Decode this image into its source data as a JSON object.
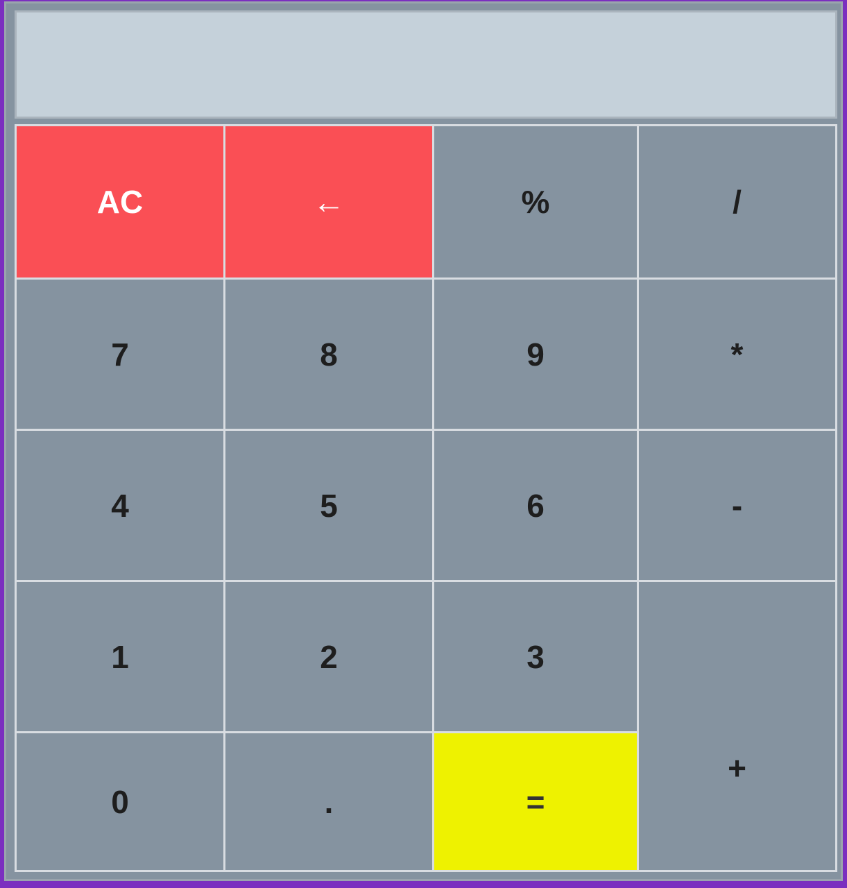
{
  "display": {
    "value": ""
  },
  "keys": {
    "clear": "AC",
    "backspace": "←",
    "percent": "%",
    "divide": "/",
    "seven": "7",
    "eight": "8",
    "nine": "9",
    "multiply": "*",
    "four": "4",
    "five": "5",
    "six": "6",
    "subtract": "-",
    "one": "1",
    "two": "2",
    "three": "3",
    "add": "+",
    "zero": "0",
    "decimal": ".",
    "equals": "="
  },
  "colors": {
    "background": "#7b2fbf",
    "display": "#c5d1da",
    "key": "#8593a0",
    "danger_key": "#fa4f55",
    "equals_key": "#eef200"
  }
}
